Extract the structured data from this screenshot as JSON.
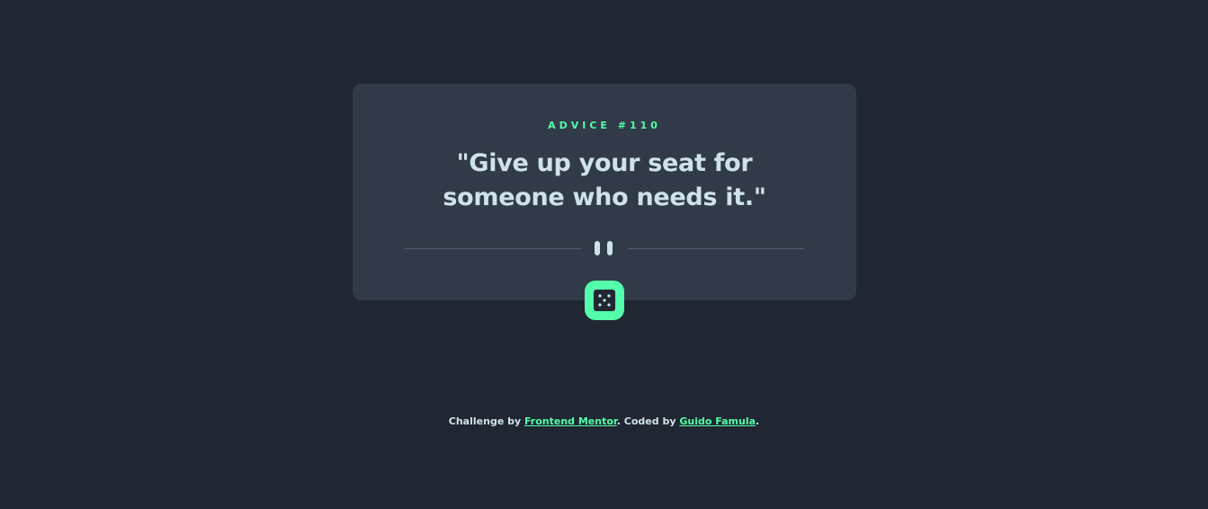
{
  "advice": {
    "id_label": "ADVICE #110",
    "text": "\"Give up your seat for someone who needs it.\""
  },
  "divider": {
    "icon": "pause-icon"
  },
  "generate_button": {
    "icon": "dice-icon"
  },
  "footer": {
    "prefix": "Challenge by ",
    "link1": "Frontend Mentor",
    "middle": ". Coded by ",
    "link2": "Guido Famula",
    "suffix": "."
  },
  "colors": {
    "background": "#202632",
    "card": "#313a48",
    "accent": "#53ffaa",
    "text": "#cee3e9",
    "divider": "#4f5d74"
  }
}
